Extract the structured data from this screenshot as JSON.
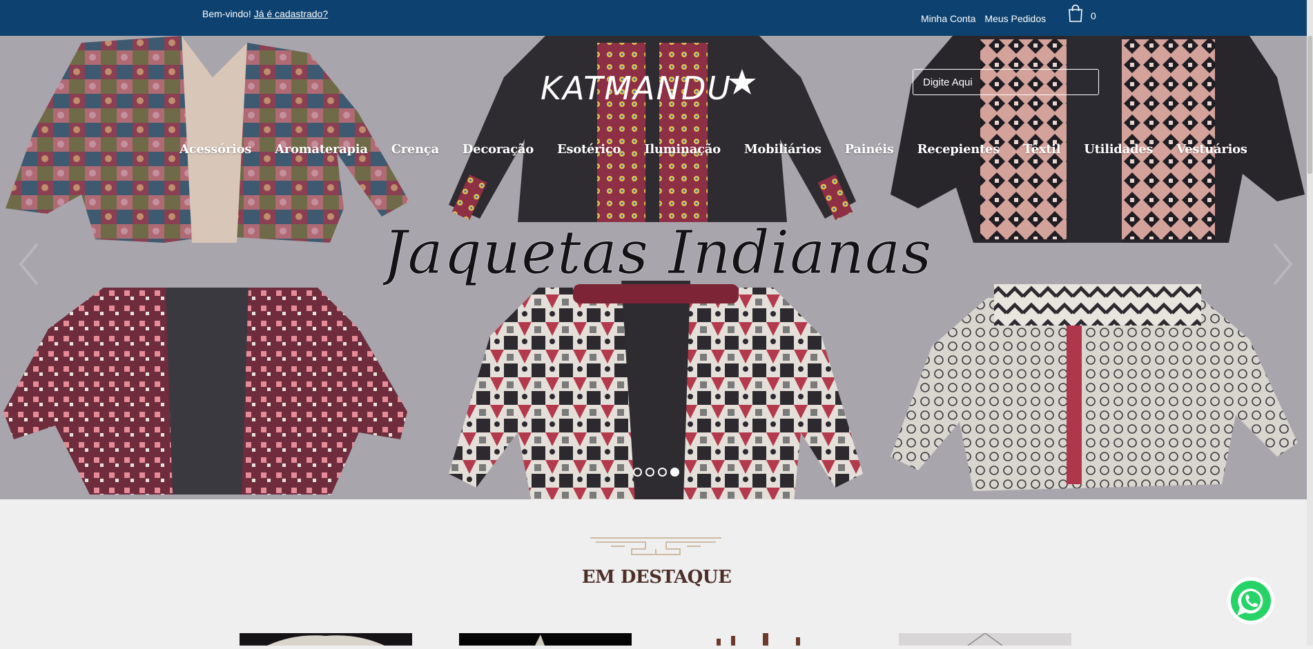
{
  "topbar": {
    "welcome_text": "Bem-vindo! ",
    "login_link": "Já é cadastrado?",
    "my_account": "Minha Conta",
    "my_orders": "Meus Pedidos",
    "cart_count": "0",
    "bg_color": "#0d4270"
  },
  "logo": {
    "text": "KATMANDU"
  },
  "search": {
    "placeholder": "Digite Aqui"
  },
  "nav": {
    "items": [
      "Acessórios",
      "Aromaterapia",
      "Crença",
      "Decoração",
      "Esotérico",
      "Iluminação",
      "Mobiliários",
      "Painéis",
      "Recepientes",
      "Têxtil",
      "Utilidades",
      "Vestuários"
    ]
  },
  "banner": {
    "headline": "Jaquetas Indianas",
    "slides_total": 4,
    "active_slide": 4
  },
  "featured": {
    "title": "EM DESTAQUE"
  },
  "icons": {
    "cart": "shopping-bag-icon",
    "prev": "chevron-left-icon",
    "next": "chevron-right-icon",
    "whatsapp": "whatsapp-icon",
    "ornament": "ornament-divider-icon"
  }
}
